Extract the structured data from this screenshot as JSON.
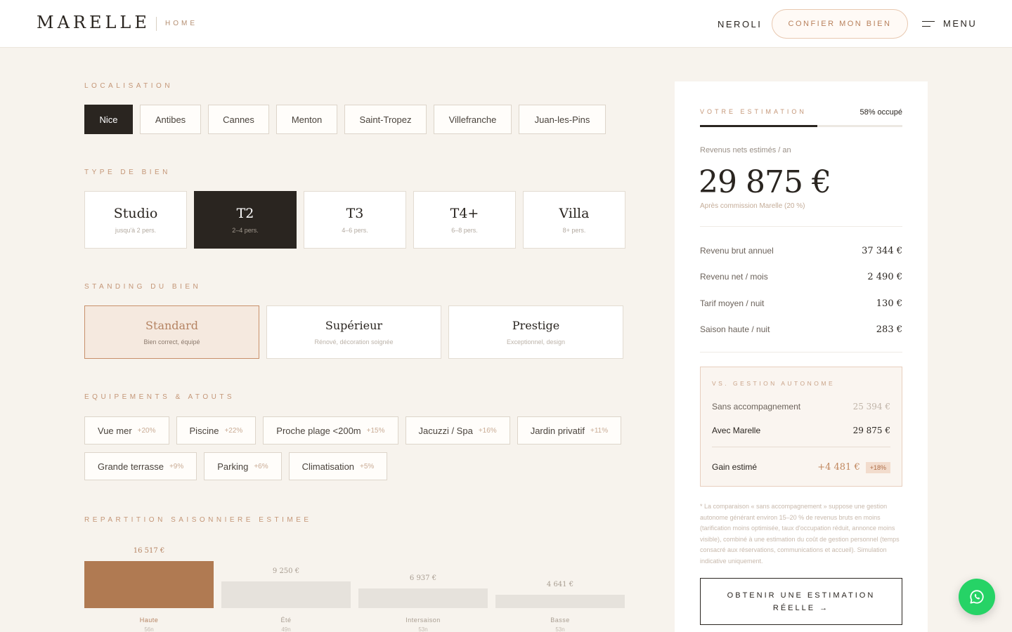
{
  "header": {
    "logo": "MARELLE",
    "logo_sub": "HOME",
    "nav_link": "NEROLI",
    "cta": "CONFIER MON BIEN",
    "menu": "MENU"
  },
  "sections": {
    "localisation": "LOCALISATION",
    "type": "TYPE DE BIEN",
    "standing": "STANDING DU BIEN",
    "equipements": "EQUIPEMENTS & ATOUTS",
    "repartition": "REPARTITION SAISONNIERE ESTIMEE"
  },
  "locations": [
    "Nice",
    "Antibes",
    "Cannes",
    "Menton",
    "Saint-Tropez",
    "Villefranche",
    "Juan-les-Pins"
  ],
  "types": [
    {
      "name": "Studio",
      "sub": "jusqu'à 2 pers."
    },
    {
      "name": "T2",
      "sub": "2–4 pers."
    },
    {
      "name": "T3",
      "sub": "4–6 pers."
    },
    {
      "name": "T4+",
      "sub": "6–8 pers."
    },
    {
      "name": "Villa",
      "sub": "8+ pers."
    }
  ],
  "standings": [
    {
      "name": "Standard",
      "sub": "Bien correct, équipé"
    },
    {
      "name": "Supérieur",
      "sub": "Rénové, décoration soignée"
    },
    {
      "name": "Prestige",
      "sub": "Exceptionnel, design"
    }
  ],
  "amenities": [
    {
      "name": "Vue mer",
      "pct": "+20%"
    },
    {
      "name": "Piscine",
      "pct": "+22%"
    },
    {
      "name": "Proche plage <200m",
      "pct": "+15%"
    },
    {
      "name": "Jacuzzi / Spa",
      "pct": "+16%"
    },
    {
      "name": "Jardin privatif",
      "pct": "+11%"
    },
    {
      "name": "Grande terrasse",
      "pct": "+9%"
    },
    {
      "name": "Parking",
      "pct": "+6%"
    },
    {
      "name": "Climatisation",
      "pct": "+5%"
    }
  ],
  "chart_data": {
    "type": "bar",
    "categories": [
      "Haute",
      "Été",
      "Intersaison",
      "Basse"
    ],
    "values": [
      16517,
      9250,
      6937,
      4641
    ],
    "value_labels": [
      "16 517 €",
      "9 250 €",
      "6 937 €",
      "4 641 €"
    ],
    "sub_labels": [
      "56n",
      "49n",
      "53n",
      "53n"
    ],
    "colors": [
      "#b07a52",
      "#e6e2dc",
      "#e6e2dc",
      "#e6e2dc"
    ]
  },
  "panel": {
    "title": "VOTRE ESTIMATION",
    "occupancy_label": "58% occupé",
    "occupancy": 0.58,
    "rev_label": "Revenus nets estimés / an",
    "rev_value": "29 875 €",
    "rev_note": "Après commission Marelle (20 %)",
    "rows": [
      {
        "k": "Revenu brut annuel",
        "v": "37 344 €"
      },
      {
        "k": "Revenu net / mois",
        "v": "2 490 €"
      },
      {
        "k": "Tarif moyen / nuit",
        "v": "130 €"
      },
      {
        "k": "Saison haute / nuit",
        "v": "283 €"
      }
    ],
    "compare": {
      "title": "VS. GESTION AUTONOME",
      "sans_label": "Sans accompagnement",
      "sans_value": "25 394 €",
      "avec_label": "Avec Marelle",
      "avec_value": "29 875 €",
      "gain_label": "Gain estimé",
      "gain_value": "+4 481 €",
      "gain_pct": "+18%"
    },
    "footnote": "* La comparaison « sans accompagnement » suppose une gestion autonome générant environ 15–20 % de revenus bruts en moins (tarification moins optimisée, taux d'occupation réduit, annonce moins visible), combiné à une estimation du coût de gestion personnel (temps consacré aux réservations, communications et accueil). Simulation indicative uniquement.",
    "cta_line1": "OBTENIR UNE ESTIMATION",
    "cta_line2": "RÉELLE →"
  },
  "colors": {
    "accent": "#b07a52",
    "dark": "#2a2520",
    "background": "#f7f3ed",
    "whatsapp": "#26d366"
  }
}
